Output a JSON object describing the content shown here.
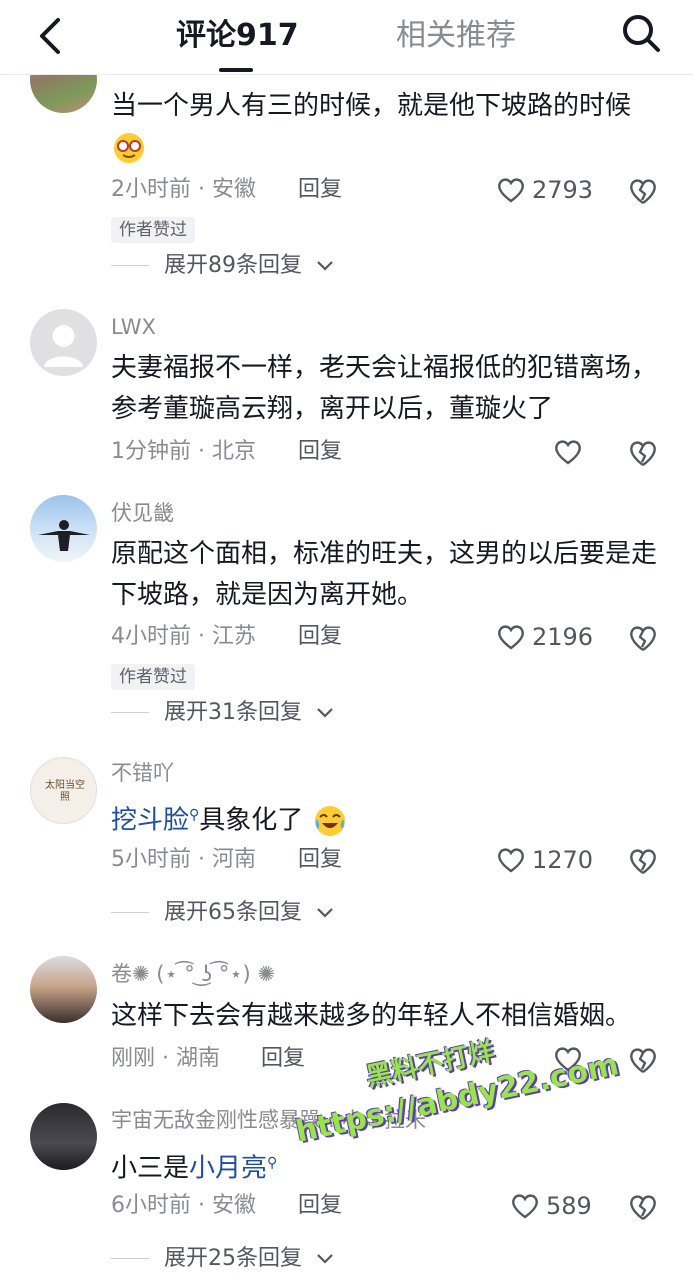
{
  "header": {
    "tab_comments": "评论917",
    "tab_related": "相关推荐"
  },
  "comments": [
    {
      "username": "",
      "text": "当一个男人有三的时候，就是他下坡路的时候",
      "emoji": "glasses-face",
      "time": "2小时前",
      "location": "安徽",
      "reply": "回复",
      "likes": "2793",
      "badge": "作者赞过",
      "expand": "展开89条回复"
    },
    {
      "username": "LWX",
      "text": "夫妻福报不一样，老天会让福报低的犯错离场，参考董璇高云翔，离开以后，董璇火了",
      "time": "1分钟前",
      "location": "北京",
      "reply": "回复",
      "likes": ""
    },
    {
      "username": "伏见畿",
      "text": "原配这个面相，标准的旺夫，这男的以后要是走下坡路，就是因为离开她。",
      "time": "4小时前",
      "location": "江苏",
      "reply": "回复",
      "likes": "2196",
      "badge": "作者赞过",
      "expand": "展开31条回复"
    },
    {
      "username": "不错吖",
      "text_link": "挖斗脸",
      "text": "具象化了",
      "emoji": "crying-laughing-face",
      "time": "5小时前",
      "location": "河南",
      "reply": "回复",
      "likes": "1270",
      "expand": "展开65条回复",
      "avatar_text": "太阳当空照"
    },
    {
      "username": "卷✺ (⋆ ͡° ͜ʖ ͡°⋆) ✺",
      "text": "这样下去会有越来越多的年轻人不相信婚姻。",
      "time": "刚刚",
      "location": "湖南",
      "reply": "回复",
      "likes": ""
    },
    {
      "username": "宇宙无敌金刚性感暴躁…小卡拉米",
      "text_prefix": "小三是",
      "text_link": "小月亮",
      "time": "6小时前",
      "location": "安徽",
      "reply": "回复",
      "likes": "589",
      "expand": "展开25条回复"
    }
  ],
  "watermark": {
    "line1": "黑料不打烊",
    "line2": "https://abdy22.com"
  },
  "colors": {
    "text": "#161823",
    "secondary": "#8a8b91",
    "link": "#1f4e9f",
    "watermark": "#9ae34a"
  }
}
